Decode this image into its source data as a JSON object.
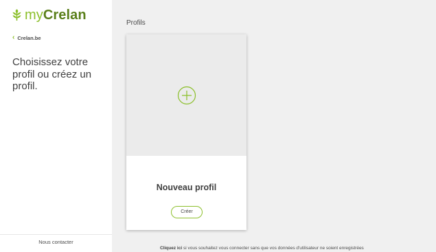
{
  "brand": {
    "my": "my",
    "name": "Crelan",
    "colors": {
      "light_green": "#8bbf2a",
      "dark_green": "#5a7f1a"
    },
    "icon": "wheat-logo-icon"
  },
  "sidebar": {
    "back_label": "Crelan.be",
    "intro_text": "Choisissez votre profil ou créez un profil.",
    "contact_label": "Nous contacter"
  },
  "main": {
    "title": "Profils",
    "new_profile": {
      "label": "Nouveau profil",
      "button_label": "Créer",
      "icon": "plus-circle-icon"
    },
    "footer": {
      "link_text": "Cliquez ici",
      "text": " si vous souhaitez vous connecter sans que vos données d'utilisateur ne soient enregistrées"
    }
  }
}
